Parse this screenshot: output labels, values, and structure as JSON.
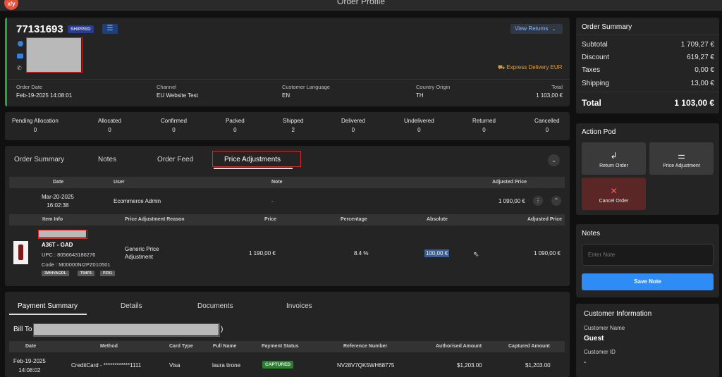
{
  "window": {
    "title": "Order Profile",
    "logo": "x/y"
  },
  "order": {
    "number": "77131693",
    "status": "SHIPPED",
    "view_returns": "View Returns",
    "delivery": "Express Delivery EUR",
    "meta": [
      {
        "label": "Order Date",
        "value": "Feb-19-2025 14:08:01"
      },
      {
        "label": "Channel",
        "value": "EU Website Test"
      },
      {
        "label": "Customer Language",
        "value": "EN"
      },
      {
        "label": "Country Origin",
        "value": "TH"
      },
      {
        "label": "Total",
        "value": "1 103,00 €"
      }
    ]
  },
  "status_counts": [
    {
      "label": "Pending Allocation",
      "value": "0"
    },
    {
      "label": "Allocated",
      "value": "0"
    },
    {
      "label": "Confirmed",
      "value": "0"
    },
    {
      "label": "Packed",
      "value": "0"
    },
    {
      "label": "Shipped",
      "value": "2"
    },
    {
      "label": "Delivered",
      "value": "0"
    },
    {
      "label": "Undelivered",
      "value": "0"
    },
    {
      "label": "Returned",
      "value": "0"
    },
    {
      "label": "Cancelled",
      "value": "0"
    }
  ],
  "tabs": [
    "Order Summary",
    "Notes",
    "Order Feed",
    "Price Adjustments"
  ],
  "adjustments": {
    "headers": [
      "Date",
      "User",
      "Note",
      "Adjusted Price"
    ],
    "row": {
      "date": "Mar-20-2025",
      "time": "16:02:38",
      "user": "Ecommerce Admin",
      "note": "-",
      "price": "1 090,00 €"
    },
    "item_headers": [
      "Item Info",
      "Price Adjustment Reason",
      "Price",
      "Percentage",
      "Absolute",
      "Adjusted Price"
    ],
    "item": {
      "name": "A36T - GAD",
      "upc": "UPC : 8056643186276",
      "code": "Code : M00000NI2PZ010501",
      "tags": [
        "3WHVAGDL",
        "T04P1",
        "PZ01"
      ],
      "reason": "Generic Price Adjustment",
      "price": "1 190,00 €",
      "percentage": "8.4 %",
      "absolute": "100,00 €",
      "adjusted": "1 090,00 €"
    }
  },
  "payment": {
    "tabs": [
      "Payment Summary",
      "Details",
      "Documents",
      "Invoices"
    ],
    "bill_to": "Bill To",
    "bill_suffix": ")",
    "headers": [
      "Date",
      "Method",
      "Card Type",
      "Full Name",
      "Payment Status",
      "Reference Number",
      "Authorised Amount",
      "Captured Amount"
    ],
    "row": {
      "date": "Feb-19-2025",
      "time": "14:08:02",
      "method": "CreditCard - ************1111",
      "card": "Visa",
      "name": "laura tirone",
      "status": "CAPTURED",
      "ref": "NV28V7QK5WH68775",
      "authorised": "$1,203.00",
      "captured": "$1,203.00"
    }
  },
  "summary": {
    "title": "Order Summary",
    "rows": [
      {
        "label": "Subtotal",
        "value": "1 709,27 €"
      },
      {
        "label": "Discount",
        "value": "619,27 €"
      },
      {
        "label": "Taxes",
        "value": "0,00 €"
      },
      {
        "label": "Shipping",
        "value": "13,00 €"
      }
    ],
    "total_label": "Total",
    "total_value": "1 103,00 €"
  },
  "pod": {
    "title": "Action Pod",
    "return_label": "Return Order",
    "adjust_label": "Price Adjustment",
    "cancel_label": "Cancel Order"
  },
  "notes": {
    "title": "Notes",
    "placeholder": "Enter Note",
    "save": "Save Note"
  },
  "customer": {
    "title": "Customer Information",
    "name_label": "Customer Name",
    "name_value": "Guest",
    "id_label": "Customer ID",
    "id_value": "-"
  },
  "colors": {
    "accent": "#2f8bf5",
    "shipped_badge": "#2a3d8c",
    "captured_badge": "#2e7d32",
    "delivery": "#e0a03a",
    "cancel_bg": "#5a2626"
  }
}
